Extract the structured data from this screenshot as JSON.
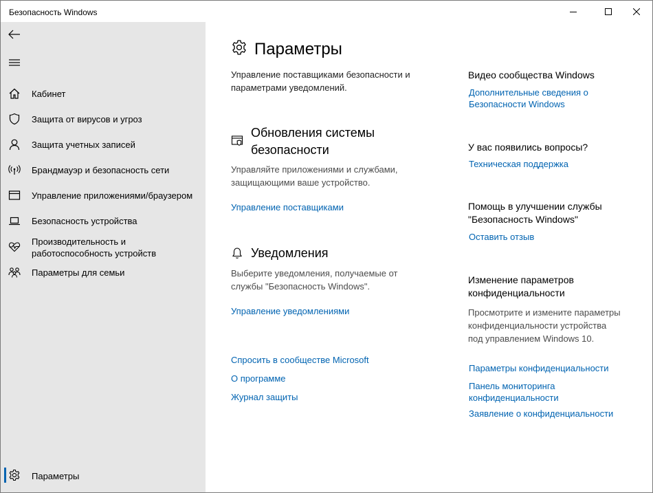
{
  "window": {
    "title": "Безопасность Windows"
  },
  "sidebar": {
    "items": [
      {
        "label": "Кабинет",
        "icon": "home-icon"
      },
      {
        "label": "Защита от вирусов и угроз",
        "icon": "shield-icon"
      },
      {
        "label": "Защита учетных записей",
        "icon": "person-icon"
      },
      {
        "label": "Брандмауэр и безопасность сети",
        "icon": "wifi-antenna-icon"
      },
      {
        "label": "Управление приложениями/браузером",
        "icon": "app-browser-icon"
      },
      {
        "label": "Безопасность устройства",
        "icon": "laptop-icon"
      },
      {
        "label": "Производительность и работоспособность устройств",
        "icon": "heart-pulse-icon"
      },
      {
        "label": "Параметры для семьи",
        "icon": "family-icon"
      }
    ],
    "settings_label": "Параметры"
  },
  "main": {
    "title": "Параметры",
    "intro": "Управление поставщиками безопасности и параметрами уведомлений.",
    "sections": [
      {
        "title": "Обновления системы безопасности",
        "description": "Управляйте приложениями и службами, защищающими ваше устройство.",
        "link": "Управление поставщиками"
      },
      {
        "title": "Уведомления",
        "description": "Выберите уведомления, получаемые от службы \"Безопасность Windows\".",
        "link": "Управление уведомлениями"
      }
    ],
    "footer_links": [
      "Спросить в сообществе Microsoft",
      "О программе",
      "Журнал защиты"
    ]
  },
  "aside": {
    "video": {
      "title": "Видео сообщества Windows",
      "link": "Дополнительные сведения о Безопасности Windows"
    },
    "questions": {
      "title": "У вас появились вопросы?",
      "link": "Техническая поддержка"
    },
    "improve": {
      "title": "Помощь в улучшении службы \"Безопасность Windows\"",
      "link": "Оставить отзыв"
    },
    "privacy": {
      "title": "Изменение параметров конфиденциальности",
      "description": "Просмотрите и измените параметры конфиденциальности устройства под управлением Windows 10.",
      "links": [
        "Параметры конфиденциальности",
        "Панель мониторинга конфиденциальности",
        "Заявление о конфиденциальности"
      ]
    }
  },
  "colors": {
    "accent": "#0063b1",
    "sidebar_bg": "#e6e6e6"
  }
}
